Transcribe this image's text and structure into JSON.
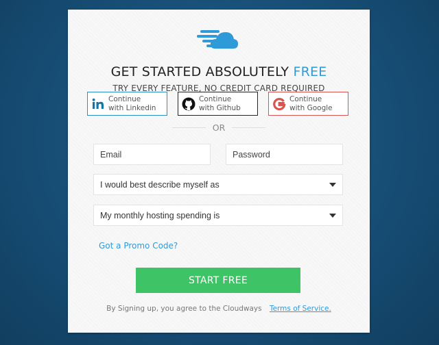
{
  "headline": {
    "prefix": "GET STARTED ABSOLUTELY",
    "accent": "FREE"
  },
  "subheadline": "TRY EVERY FEATURE, NO CREDIT CARD REQUIRED",
  "social": {
    "linkedin": {
      "line1": "Continue",
      "line2": "with Linkedin",
      "icon": "linkedin-icon"
    },
    "github": {
      "line1": "Continue",
      "line2": "with Github",
      "icon": "github-icon"
    },
    "google": {
      "line1": "Continue",
      "line2": "with Google",
      "icon": "google-icon"
    }
  },
  "divider_text": "OR",
  "form": {
    "email_placeholder": "Email",
    "password_placeholder": "Password",
    "describe_select": "I would best describe myself as",
    "spending_select": "My monthly hosting spending is"
  },
  "promo_link": "Got a Promo Code?",
  "start_button": "START FREE",
  "terms": {
    "text": "By Signing up, you agree to the Cloudways",
    "link": "Terms of Service."
  },
  "colors": {
    "accent": "#2f9ad8",
    "button": "#3ec466",
    "linkedin": "#0e76a8",
    "google": "#d9534f"
  }
}
